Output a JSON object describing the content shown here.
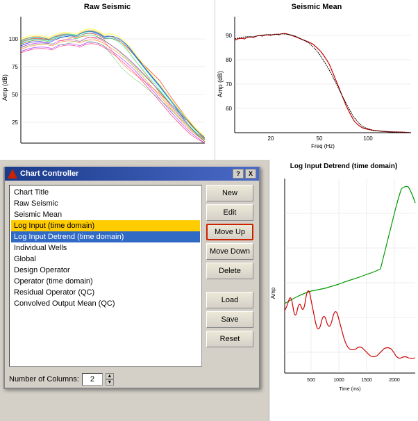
{
  "app": {
    "title": "Chart Controller"
  },
  "top_charts": {
    "raw_seismic": {
      "title": "Raw Seismic",
      "x_label": "",
      "y_label": "Amp (dB)"
    },
    "seismic_mean": {
      "title": "Seismic Mean",
      "x_label": "Freq (Hz)",
      "y_label": "Amp (dB)"
    }
  },
  "dialog": {
    "title": "Chart Controller",
    "help_btn": "?",
    "close_btn": "X",
    "chart_items": [
      {
        "label": "Chart Title",
        "id": "chart-title"
      },
      {
        "label": "Raw Seismic",
        "id": "raw-seismic"
      },
      {
        "label": "Seismic Mean",
        "id": "seismic-mean"
      },
      {
        "label": "Log Input (time domain)",
        "id": "log-input"
      },
      {
        "label": "Log Input Detrend (time domain)",
        "id": "log-input-detrend",
        "selected": true
      },
      {
        "label": "Individual Wells",
        "id": "individual-wells"
      },
      {
        "label": "Global",
        "id": "global"
      },
      {
        "label": "Design Operator",
        "id": "design-operator"
      },
      {
        "label": "Operator (time domain)",
        "id": "operator"
      },
      {
        "label": "Residual Operator (QC)",
        "id": "residual-operator"
      },
      {
        "label": "Convolved Output Mean (QC)",
        "id": "convolved-output"
      }
    ],
    "buttons": {
      "new": "New",
      "edit": "Edit",
      "move_up": "Move Up",
      "move_down": "Move Down",
      "delete": "Delete",
      "load": "Load",
      "save": "Save",
      "reset": "Reset"
    },
    "footer": {
      "label": "Number of Columns:",
      "value": "2"
    }
  },
  "bottom_right_chart": {
    "title": "Log Input Detrend (time domain)",
    "x_label": "Time (ms)",
    "y_label": "Amp"
  }
}
